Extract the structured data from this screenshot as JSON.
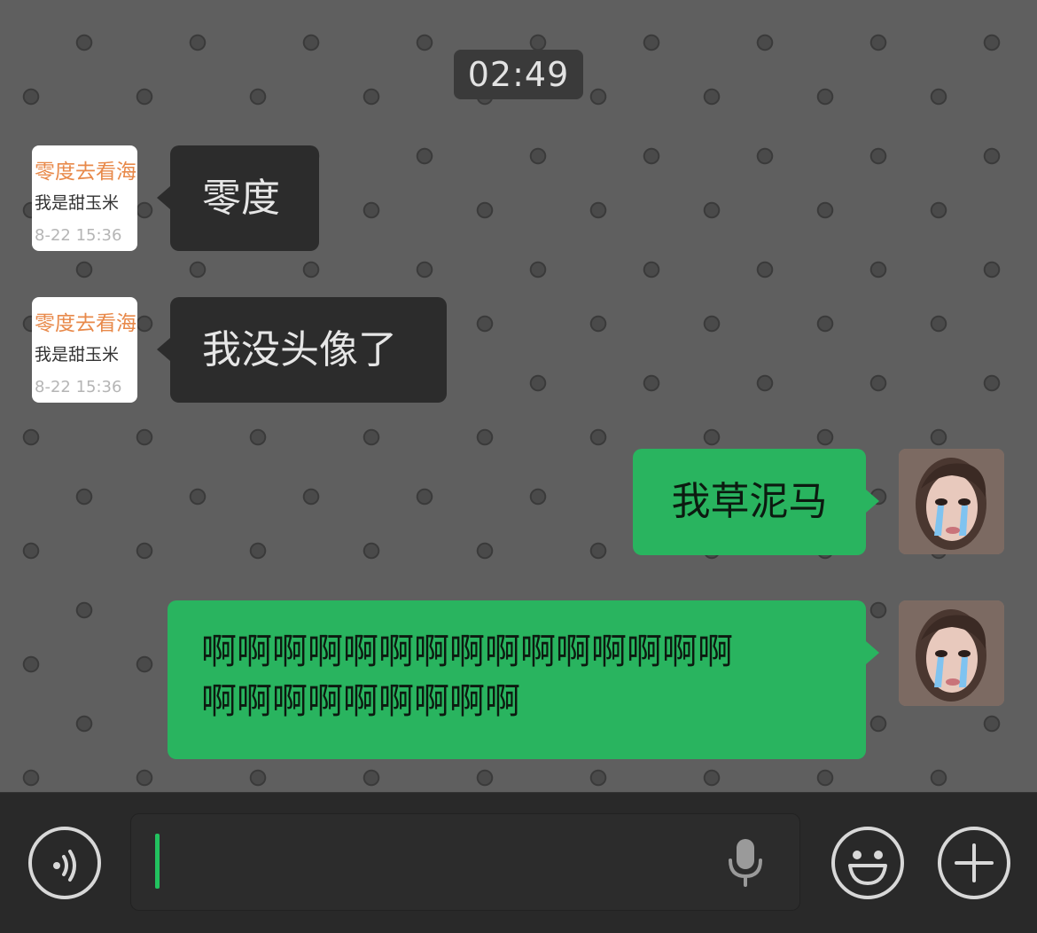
{
  "status": {
    "time": "02:49"
  },
  "messages": [
    {
      "side": "incoming",
      "text": "零度",
      "avatar": {
        "title": "零度去看海",
        "subtitle": "我是甜玉米",
        "date": "8-22 15:36"
      }
    },
    {
      "side": "incoming",
      "text": "我没头像了",
      "avatar": {
        "title": "零度去看海",
        "subtitle": "我是甜玉米",
        "date": "8-22 15:36"
      }
    },
    {
      "side": "outgoing",
      "text": "我草泥马",
      "avatar": {
        "icon": "user-photo"
      }
    },
    {
      "side": "outgoing",
      "lines": [
        "啊啊啊啊啊啊啊啊啊啊啊啊啊啊啊",
        "啊啊啊啊啊啊啊啊啊"
      ],
      "avatar": {
        "icon": "user-photo"
      }
    }
  ],
  "input_bar": {
    "voice_button_icon": "voice-icon",
    "input_value": "",
    "mic_icon": "microphone-icon",
    "emoji_button_icon": "emoji-icon",
    "more_button_icon": "plus-icon"
  },
  "colors": {
    "chat_background": "#5f5f5f",
    "incoming_bubble": "#2c2c2c",
    "outgoing_bubble": "#29b45f",
    "input_bar": "#292929",
    "caret": "#22c25f",
    "card_title": "#e8894a"
  }
}
